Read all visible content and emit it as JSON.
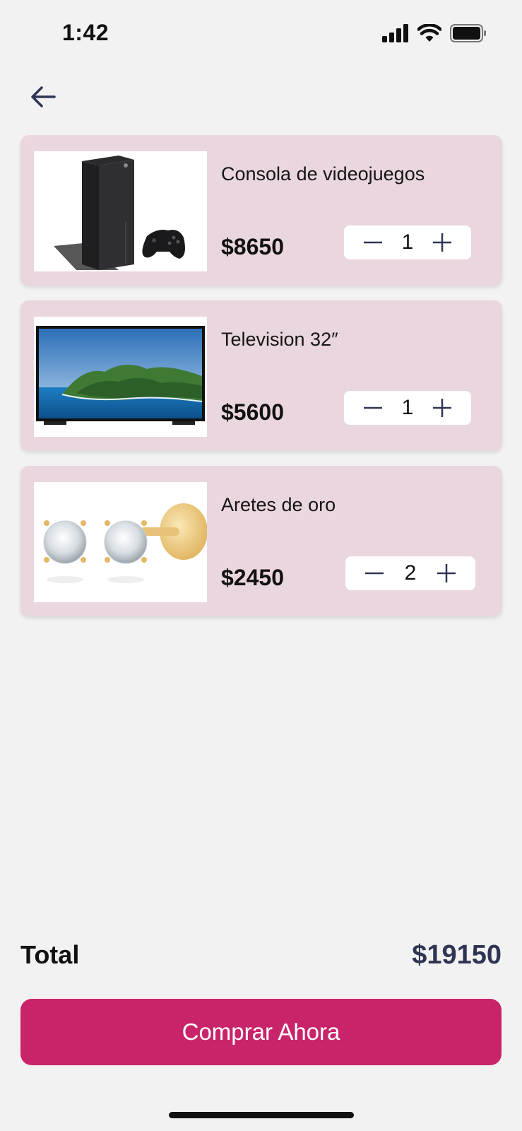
{
  "status_bar": {
    "time": "1:42",
    "signal_icon": "signal-bars-icon",
    "wifi_icon": "wifi-icon",
    "battery_icon": "battery-icon"
  },
  "nav": {
    "back_icon": "arrow-left-icon"
  },
  "cart": {
    "items": [
      {
        "name": "Consola de videojuegos",
        "price": "$8650",
        "quantity": "1",
        "image": "game-console-image"
      },
      {
        "name": "Television 32″",
        "price": "$5600",
        "quantity": "1",
        "image": "television-image"
      },
      {
        "name": "Aretes de oro",
        "price": "$2450",
        "quantity": "2",
        "image": "gold-earrings-image"
      }
    ]
  },
  "summary": {
    "total_label": "Total",
    "total_value": "$19150"
  },
  "actions": {
    "buy_label": "Comprar Ahora"
  },
  "colors": {
    "background": "#f2f2f2",
    "card": "#ead6df",
    "accent": "#c9246a",
    "total_text": "#2f3553"
  }
}
